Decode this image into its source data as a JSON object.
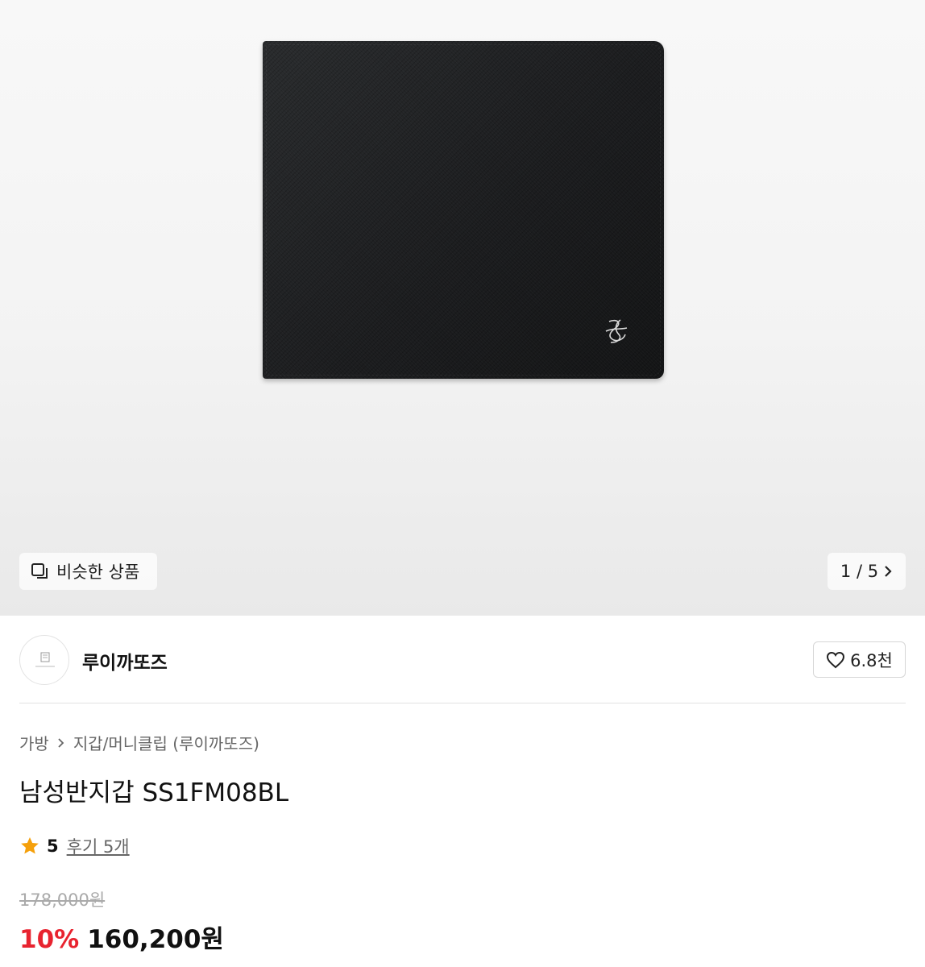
{
  "gallery": {
    "similar_label": "비슷한 상품",
    "counter": "1 / 5"
  },
  "brand": {
    "name": "루이까또즈",
    "likes": "6.8천"
  },
  "product": {
    "breadcrumb": [
      "가방",
      "지갑/머니클립 (루이까또즈)"
    ],
    "title": "남성반지갑 SS1FM08BL",
    "rating": "5",
    "reviews": "후기 5개",
    "original_price": "178,000원",
    "discount": "10%",
    "price": "160,200원"
  },
  "colors": {
    "discount": "#e8232f",
    "star": "#f5a00b"
  }
}
